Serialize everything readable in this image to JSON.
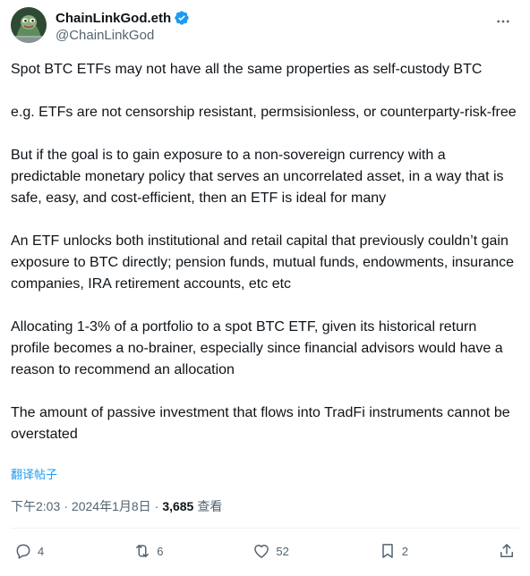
{
  "author": {
    "display_name": "ChainLinkGod.eth",
    "handle": "@ChainLinkGod",
    "verified": true
  },
  "tweet": {
    "paragraphs": [
      "Spot BTC ETFs may not have all the same properties as self-custody BTC",
      "e.g. ETFs are not censorship resistant, permsisionless, or counterparty-risk-free",
      "But if the goal is to gain exposure to a non-sovereign currency with a predictable monetary policy that serves an uncorrelated asset, in a way that is safe, easy, and cost-efficient, then an ETF is ideal for many",
      "An ETF unlocks both institutional and retail capital that previously couldn’t gain exposure to BTC directly; pension funds, mutual funds, endowments, insurance companies, IRA retirement accounts, etc etc",
      "Allocating 1-3% of a portfolio to a spot BTC ETF, given its historical return profile becomes a no-brainer, especially since financial advisors would have a reason to recommend an allocation",
      "The amount of passive investment that flows into TradFi instruments cannot be overstated"
    ],
    "translate_label": "翻译帖子",
    "time": "下午2:03",
    "separator": "·",
    "date": "2024年1月8日",
    "views_count": "3,685",
    "views_label": "查看"
  },
  "actions": {
    "reply_count": "4",
    "retweet_count": "6",
    "like_count": "52",
    "bookmark_count": "2"
  },
  "colors": {
    "accent": "#1d9bf0",
    "secondary_text": "#536471",
    "primary_text": "#0f1419"
  }
}
